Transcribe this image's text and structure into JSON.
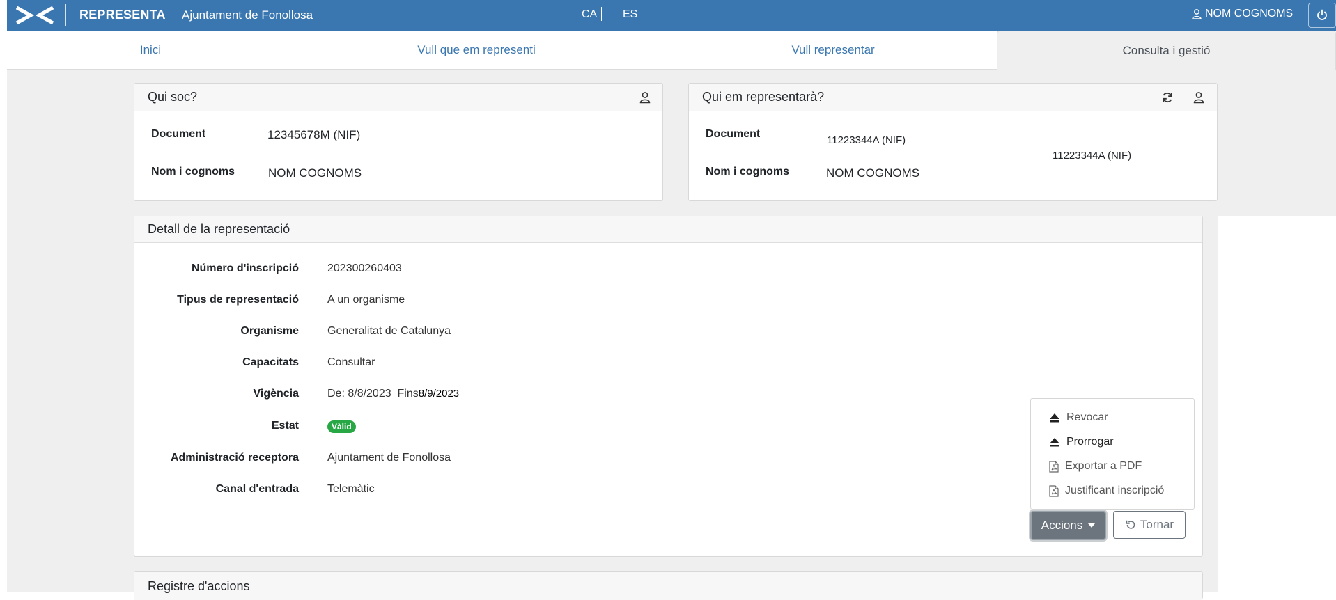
{
  "header": {
    "brand": "REPRESENTA",
    "organization": "Ajuntament de Fonollosa",
    "languages": [
      "CA",
      "ES"
    ],
    "user_name": "NOM COGNOMS",
    "color": "#3a77b0"
  },
  "tabs": [
    {
      "label": "Inici",
      "active": false
    },
    {
      "label": "Vull que em representi",
      "active": false
    },
    {
      "label": "Vull representar",
      "active": false
    },
    {
      "label": "Consulta i gestió",
      "active": true
    }
  ],
  "qui_soc": {
    "title": "Qui soc?",
    "document_label": "Document",
    "document_value": "12345678M (NIF)",
    "name_label": "Nom i cognoms",
    "name_value": "NOM COGNOMS"
  },
  "qui_em_representara": {
    "title": "Qui em representarà?",
    "document_label": "Document",
    "document_value": "11223344A (NIF)",
    "document_value_2": "11223344A (NIF)",
    "name_label": "Nom i cognoms",
    "name_value": "NOM COGNOMS"
  },
  "detail": {
    "title": "Detall de la representació",
    "rows": [
      {
        "label": "Número d'inscripció",
        "value": "202300260403"
      },
      {
        "label": "Tipus de representació",
        "value": "A un organisme"
      },
      {
        "label": "Organisme",
        "value": "Generalitat de Catalunya"
      },
      {
        "label": "Capacitats",
        "value": "Consultar"
      },
      {
        "label": "Vigència",
        "value": "De: 8/8/2023  Fins"
      },
      {
        "label": "Estat",
        "value": "Vàlid"
      },
      {
        "label": "Administració receptora",
        "value": "Ajuntament de Fonollosa"
      },
      {
        "label": "Canal d'entrada",
        "value": "Telemàtic"
      }
    ],
    "vigencia_fins": "8/9/2023",
    "status_color": "#28a745"
  },
  "actions_menu": {
    "items": [
      "Revocar",
      "Prorrogar",
      "Exportar a PDF",
      "Justificant inscripció"
    ]
  },
  "buttons": {
    "accions": "Accions",
    "tornar": "Tornar"
  },
  "registre": {
    "title": "Registre d'accions"
  }
}
